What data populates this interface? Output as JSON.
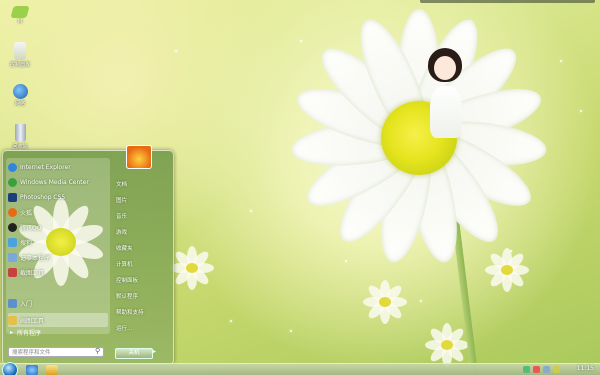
{
  "desktop_icons": [
    {
      "name": "computer-icon",
      "label": "M",
      "color": "#9bd04a"
    },
    {
      "name": "documents-icon",
      "label": "控制面板",
      "color": "#f0f0f0"
    },
    {
      "name": "network-icon",
      "label": "网络",
      "color": "#2b7bd6"
    },
    {
      "name": "recycle-bin-icon",
      "label": "回收站",
      "color": "#dfe6e9"
    }
  ],
  "start_menu": {
    "programs": [
      {
        "label": "Internet Explorer",
        "icon": "ie-icon",
        "color": "#2f86e0"
      },
      {
        "label": "Windows Media Center",
        "icon": "media-center-icon",
        "color": "#39a23d"
      },
      {
        "label": "Photoshop CS5",
        "icon": "photoshop-icon",
        "color": "#1b3f7a"
      },
      {
        "label": "火狐",
        "icon": "firefox-icon",
        "color": "#e86a12"
      },
      {
        "label": "腾讯QQ",
        "icon": "qq-icon",
        "color": "#222222"
      },
      {
        "label": "搜狗",
        "icon": "sogou-icon",
        "color": "#4aa3e0"
      },
      {
        "label": "记事本程序",
        "icon": "notepad-icon",
        "color": "#7aa8d8"
      },
      {
        "label": "截图工具",
        "icon": "snipping-icon",
        "color": "#c84040"
      },
      {
        "label": "入门",
        "icon": "getting-started-icon",
        "color": "#5a8fd0"
      },
      {
        "label": "画图工具",
        "icon": "paint-icon",
        "color": "#e2c04a"
      }
    ],
    "all_programs_label": "所有程序",
    "search_placeholder": "搜索程序和文件",
    "shutdown_label": "关机",
    "right_links": [
      "文档",
      "图片",
      "音乐",
      "游戏",
      "收藏夹",
      "计算机",
      "控制面板",
      "默认程序",
      "帮助和支持",
      "运行..."
    ]
  },
  "taskbar": {
    "clock": "11:15"
  }
}
